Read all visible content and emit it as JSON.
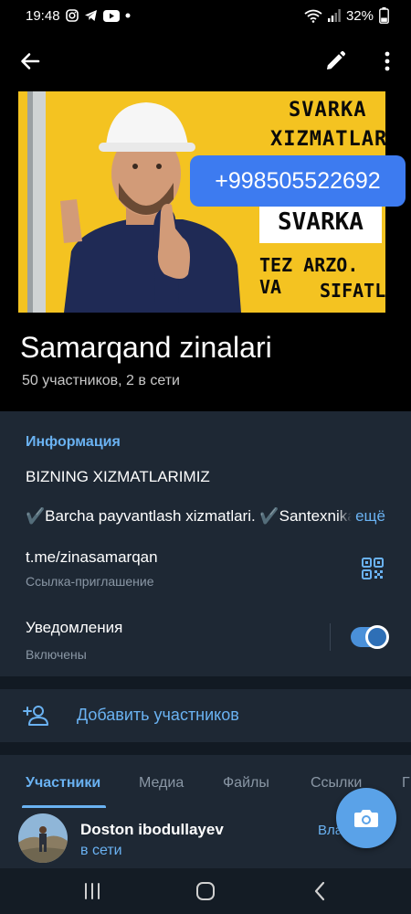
{
  "status_bar": {
    "time": "19:48",
    "battery": "32%"
  },
  "banner": {
    "line1": "SVARKA",
    "line2": "XIZMATLARI",
    "phone": "+998505522692",
    "line3": "SVARKA",
    "line4": "TEZ ARZO. VA",
    "line5": "SIFATLI"
  },
  "group": {
    "title": "Samarqand zinalari",
    "subtitle": "50 участников, 2 в сети"
  },
  "info": {
    "heading": "Информация",
    "line1": "BIZNING XIZMATLARIMIZ",
    "line2": "✔️Barcha payvantlash xizmatlari. ✔️Santexnika",
    "more": "ещё",
    "link": "t.me/zinasamarqan",
    "link_sub": "Ссылка-приглашение",
    "notifications_label": "Уведомления",
    "notifications_sub": "Включены"
  },
  "actions": {
    "add_members": "Добавить участников"
  },
  "tabs": [
    "Участники",
    "Медиа",
    "Файлы",
    "Ссылки",
    "Г"
  ],
  "members": [
    {
      "name": "Doston ibodullayev",
      "status": "в сети",
      "role": "Вла"
    }
  ],
  "colors": {
    "accent": "#6ab2f2",
    "panel": "#1e2834",
    "banner": "#f4c321",
    "phone_badge": "#3d7bf0"
  }
}
